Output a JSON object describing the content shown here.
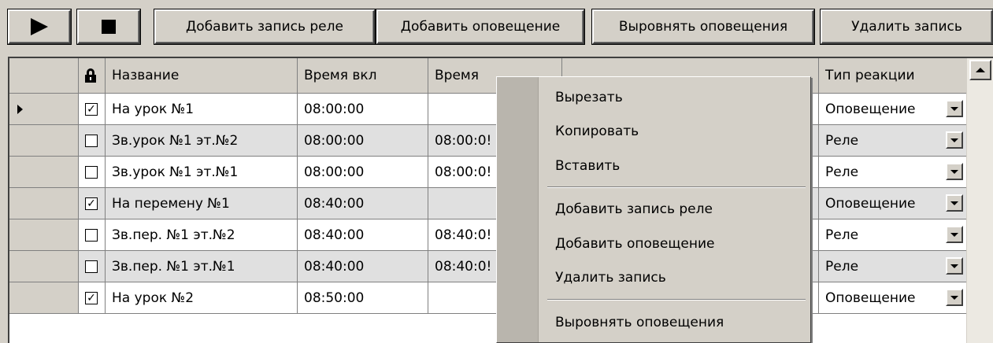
{
  "toolbar": {
    "add_relay_label": "Добавить запись реле",
    "add_alert_label": "Добавить оповещение",
    "align_label": "Выровнять оповещения",
    "delete_label": "Удалить запись"
  },
  "grid": {
    "columns": [
      "Название",
      "Время вкл",
      "Время",
      "",
      "Тип реакции"
    ],
    "rows": [
      {
        "current": true,
        "locked": true,
        "name": "На урок №1",
        "on": "08:00:00",
        "off": "",
        "type": "Оповещение"
      },
      {
        "current": false,
        "locked": false,
        "name": "Зв.урок №1 эт.№2",
        "on": "08:00:00",
        "off": "08:00:0!",
        "type": "Реле"
      },
      {
        "current": false,
        "locked": false,
        "name": "Зв.урок №1 эт.№1",
        "on": "08:00:00",
        "off": "08:00:0!",
        "type": "Реле"
      },
      {
        "current": false,
        "locked": true,
        "name": "На перемену №1",
        "on": "08:40:00",
        "off": "",
        "type": "Оповещение"
      },
      {
        "current": false,
        "locked": false,
        "name": "Зв.пер. №1 эт.№2",
        "on": "08:40:00",
        "off": "08:40:0!",
        "type": "Реле"
      },
      {
        "current": false,
        "locked": false,
        "name": "Зв.пер. №1 эт.№1",
        "on": "08:40:00",
        "off": "08:40:0!",
        "type": "Реле"
      },
      {
        "current": false,
        "locked": true,
        "name": "На урок №2",
        "on": "08:50:00",
        "off": "",
        "type": "Оповещение"
      }
    ]
  },
  "context_menu": {
    "items": [
      "Вырезать",
      "Копировать",
      "Вставить",
      "Добавить запись реле",
      "Добавить оповещение",
      "Удалить запись",
      "Выровнять оповещения"
    ]
  },
  "colors": {
    "face": "#d4d0c8",
    "row_alt": "#e0e0e0",
    "white": "#ffffff"
  }
}
